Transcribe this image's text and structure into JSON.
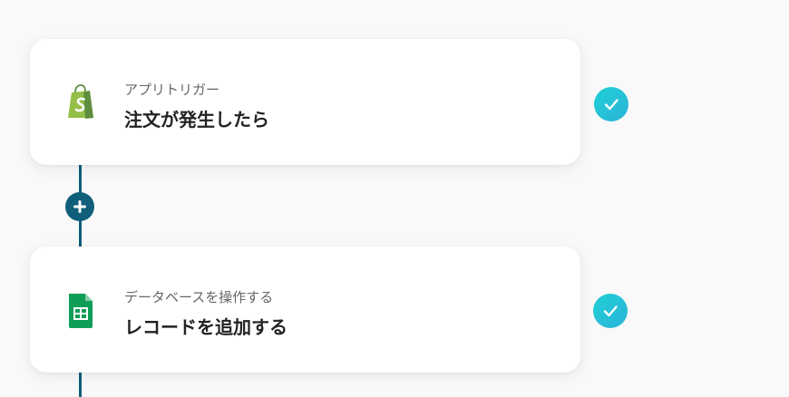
{
  "flow": {
    "steps": [
      {
        "subtitle": "アプリトリガー",
        "title": "注文が発生したら",
        "icon": "shopify-icon",
        "status": "completed"
      },
      {
        "subtitle": "データベースを操作する",
        "title": "レコードを追加する",
        "icon": "google-sheets-icon",
        "status": "completed"
      }
    ],
    "add_step_icon": "plus-icon"
  },
  "colors": {
    "connector": "#0f5f7a",
    "check_gradient_start": "#1fd0d6",
    "check_gradient_end": "#2bb3d9",
    "shopify_green": "#95bf47",
    "sheets_green": "#0f9d58"
  }
}
